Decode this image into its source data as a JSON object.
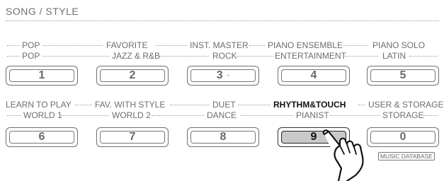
{
  "panel_title": "SONG / STYLE",
  "rows": [
    {
      "keys": [
        {
          "number": "1",
          "label_top": "POP",
          "label_bottom": "POP"
        },
        {
          "number": "2",
          "label_top": "FAVORITE",
          "label_bottom": "JAZZ & R&B"
        },
        {
          "number": "3",
          "label_top": "INST. MASTER",
          "label_bottom": "ROCK",
          "indicator": "◦"
        },
        {
          "number": "4",
          "label_top": "PIANO ENSEMBLE",
          "label_bottom": "ENTERTAINMENT"
        },
        {
          "number": "5",
          "label_top": "PIANO SOLO",
          "label_bottom": "LATIN"
        }
      ]
    },
    {
      "keys": [
        {
          "number": "6",
          "label_top": "LEARN TO PLAY",
          "label_bottom": "WORLD 1"
        },
        {
          "number": "7",
          "label_top": "FAV. WITH STYLE",
          "label_bottom": "WORLD 2"
        },
        {
          "number": "8",
          "label_top": "DUET",
          "label_bottom": "DANCE"
        },
        {
          "number": "9",
          "label_top": "RHYTHM&TOUCH",
          "label_bottom": "PIANIST",
          "pressed": true
        },
        {
          "number": "0",
          "label_top": "USER & STORAGE",
          "label_bottom": "STORAGE"
        }
      ]
    }
  ],
  "badge_label": "MUSIC DATABASE",
  "highlight_color": "#111111",
  "pressed_key_fill": "#c9c9c9",
  "icons": {
    "hand": "pointing-hand-icon"
  }
}
